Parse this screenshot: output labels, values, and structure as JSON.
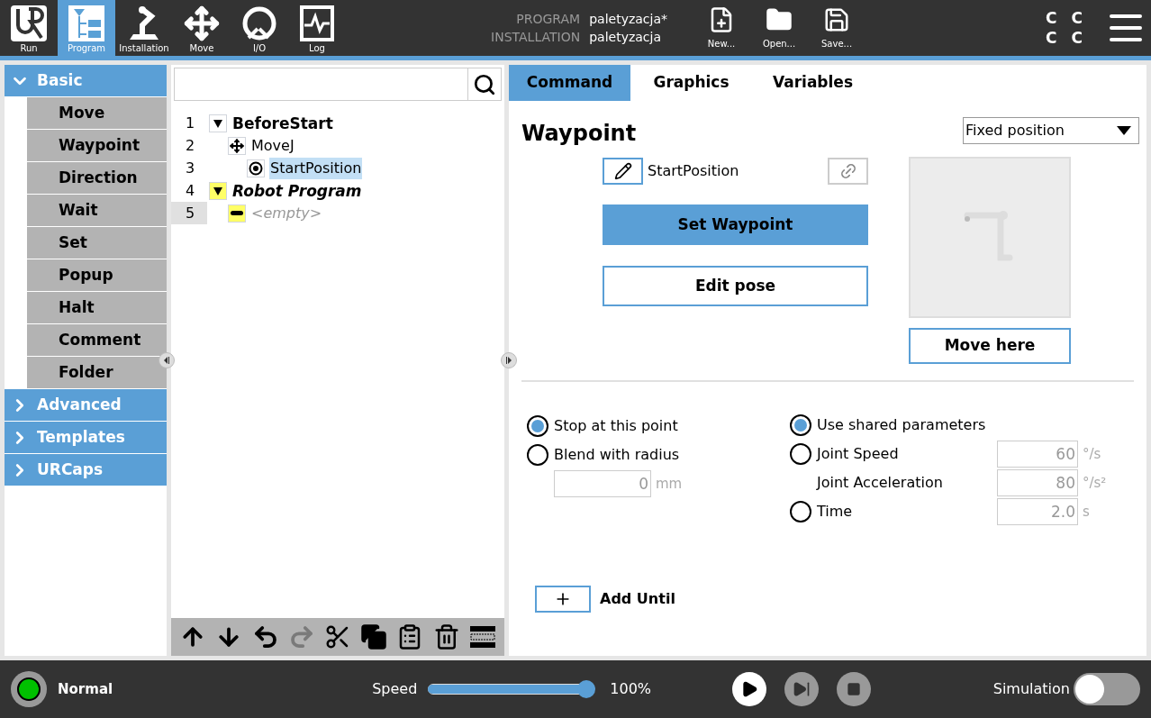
{
  "header": {
    "nav": [
      {
        "label": "Run",
        "kind": "run",
        "selected": false
      },
      {
        "label": "Program",
        "kind": "program",
        "selected": true
      },
      {
        "label": "Installation",
        "kind": "installation",
        "selected": false
      },
      {
        "label": "Move",
        "kind": "move",
        "selected": false
      },
      {
        "label": "I/O",
        "kind": "io",
        "selected": false
      },
      {
        "label": "Log",
        "kind": "log",
        "selected": false
      }
    ],
    "program_label": "PROGRAM",
    "program_name": "paletyzacja*",
    "installation_label": "INSTALLATION",
    "installation_name": "paletyzacja",
    "file_buttons": [
      {
        "label": "New...",
        "kind": "new"
      },
      {
        "label": "Open...",
        "kind": "open"
      },
      {
        "label": "Save...",
        "kind": "save"
      }
    ],
    "mode_letters": [
      "C",
      "C",
      "C",
      "C"
    ]
  },
  "sidebar": {
    "sections": [
      {
        "label": "Basic",
        "expanded": true,
        "items": [
          "Move",
          "Waypoint",
          "Direction",
          "Wait",
          "Set",
          "Popup",
          "Halt",
          "Comment",
          "Folder"
        ]
      },
      {
        "label": "Advanced",
        "expanded": false
      },
      {
        "label": "Templates",
        "expanded": false
      },
      {
        "label": "URCaps",
        "expanded": false
      }
    ]
  },
  "tree": {
    "nodes": [
      {
        "number": "1",
        "label": "BeforeStart",
        "kind": "folder",
        "selected": false,
        "current": false,
        "children": [
          {
            "number": "2",
            "label": "MoveJ",
            "kind": "movej",
            "selected": false,
            "current": false,
            "children": [
              {
                "number": "3",
                "label": "StartPosition",
                "kind": "waypoint",
                "selected": true,
                "current": false
              }
            ]
          }
        ]
      },
      {
        "number": "4",
        "label": "Robot Program",
        "kind": "program",
        "selected": false,
        "current": false,
        "children": [
          {
            "number": "5",
            "label": "<empty>",
            "kind": "empty",
            "selected": false,
            "current": true
          }
        ]
      }
    ],
    "toolbar": [
      {
        "kind": "up",
        "disabled": false
      },
      {
        "kind": "down",
        "disabled": false
      },
      {
        "kind": "undo",
        "disabled": false
      },
      {
        "kind": "redo",
        "disabled": true
      },
      {
        "kind": "cut",
        "disabled": false
      },
      {
        "kind": "copy",
        "disabled": false
      },
      {
        "kind": "paste",
        "disabled": false
      },
      {
        "kind": "delete",
        "disabled": false
      },
      {
        "kind": "suppress",
        "disabled": false
      }
    ]
  },
  "editor": {
    "tabs": [
      {
        "label": "Command",
        "selected": true
      },
      {
        "label": "Graphics",
        "selected": false
      },
      {
        "label": "Variables",
        "selected": false
      }
    ],
    "title": "Waypoint",
    "position_type": "Fixed position",
    "waypoint_name": "StartPosition",
    "set_waypoint": "Set Waypoint",
    "edit_pose": "Edit pose",
    "move_here": "Move here",
    "blend_options": [
      {
        "label": "Stop at this point",
        "selected": true
      },
      {
        "label": "Blend with radius",
        "selected": false
      }
    ],
    "radius": {
      "value": "0",
      "unit": "mm"
    },
    "parameters": [
      {
        "kind": "radio",
        "label": "Use shared parameters",
        "selected": true
      },
      {
        "kind": "radio_field",
        "label": "Joint Speed",
        "selected": false,
        "value": "60",
        "unit": "°/s"
      },
      {
        "kind": "field",
        "label": "Joint Acceleration",
        "value": "80",
        "unit": "°/s²"
      },
      {
        "kind": "radio_field",
        "label": "Time",
        "selected": false,
        "value": "2.0",
        "unit": "s"
      }
    ],
    "add_until": "Add Until"
  },
  "footer": {
    "status": "Normal",
    "speed_label": "Speed",
    "speed": {
      "level": 1.0
    },
    "speed_reading": "100%",
    "simulation_label": "Simulation",
    "simulation_on": false
  }
}
